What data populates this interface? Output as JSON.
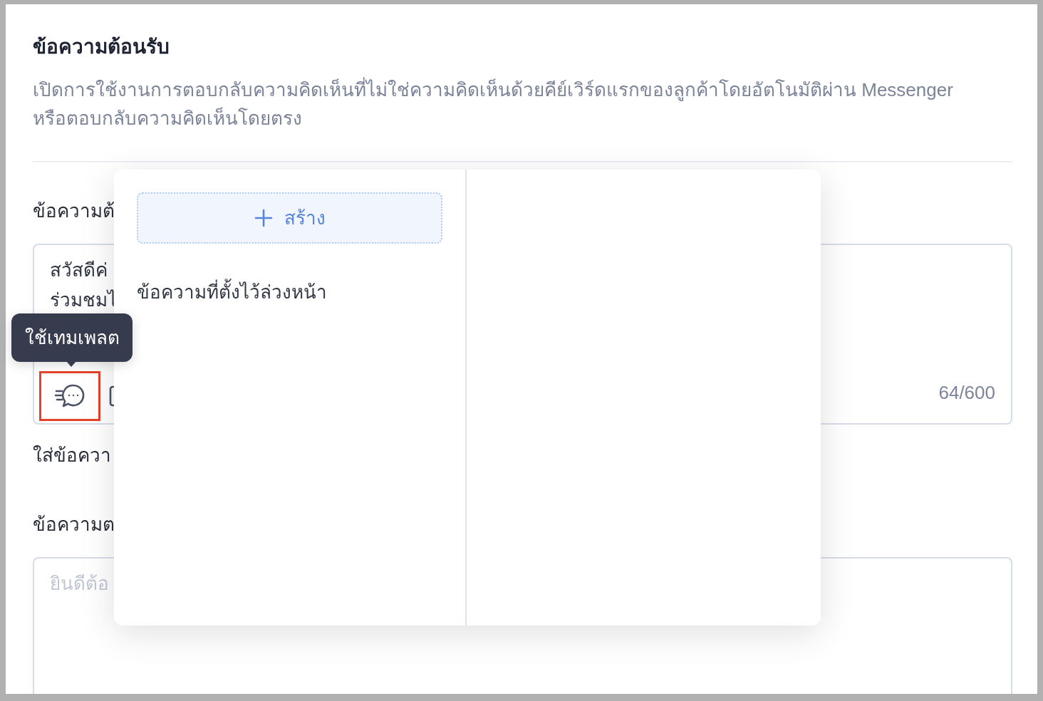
{
  "header": {
    "title": "ข้อความต้อนรับ",
    "description": "เปิดการใช้งานการตอบกลับความคิดเห็นที่ไม่ใช่ความคิดเห็นด้วยคีย์เวิร์ดแรกของลูกค้าโดยอัตโนมัติผ่าน Messenger หรือตอบกลับความคิดเห็นโดยตรง"
  },
  "fields": [
    {
      "label": "ข้อความต้",
      "value_lines": [
        "สวัสดีค่",
        "ร่วมชมไ"
      ],
      "toolbar": [
        {
          "kind": "template",
          "highlighted": true
        },
        {
          "kind": "document",
          "highlighted": false
        }
      ],
      "counter": "64/600",
      "hint": "ใส่ข้อควา"
    },
    {
      "label": "ข้อความต",
      "placeholder": "ยินดีต้อ"
    }
  ],
  "tooltip": {
    "text": "ใช้เทมเพลต"
  },
  "template_popup": {
    "create_button": {
      "label": "สร้าง"
    },
    "list_title": "ข้อความที่ตั้งไว้ล่วงหน้า"
  }
}
